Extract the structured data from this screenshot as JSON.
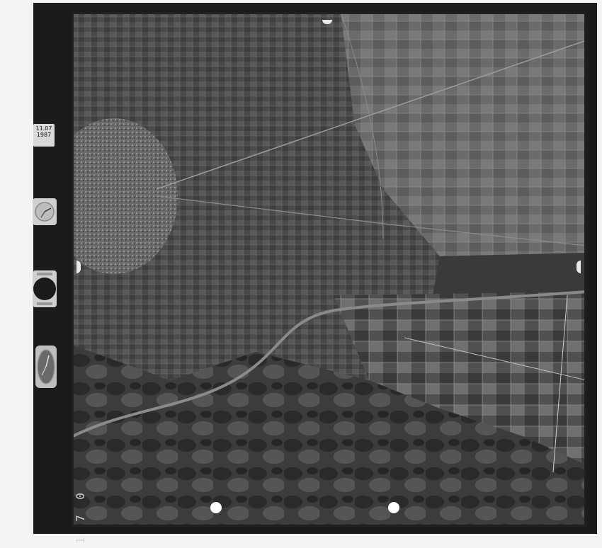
{
  "strip": {
    "date_line1": "11.07",
    "date_line2": "1987"
  },
  "frame_number": "1 7 0",
  "colors": {
    "film_border": "#1b1b1b",
    "paper": "#f4f4f2"
  },
  "icons": [
    "altimeter-icon",
    "level-bubble-icon",
    "clock-icon"
  ]
}
